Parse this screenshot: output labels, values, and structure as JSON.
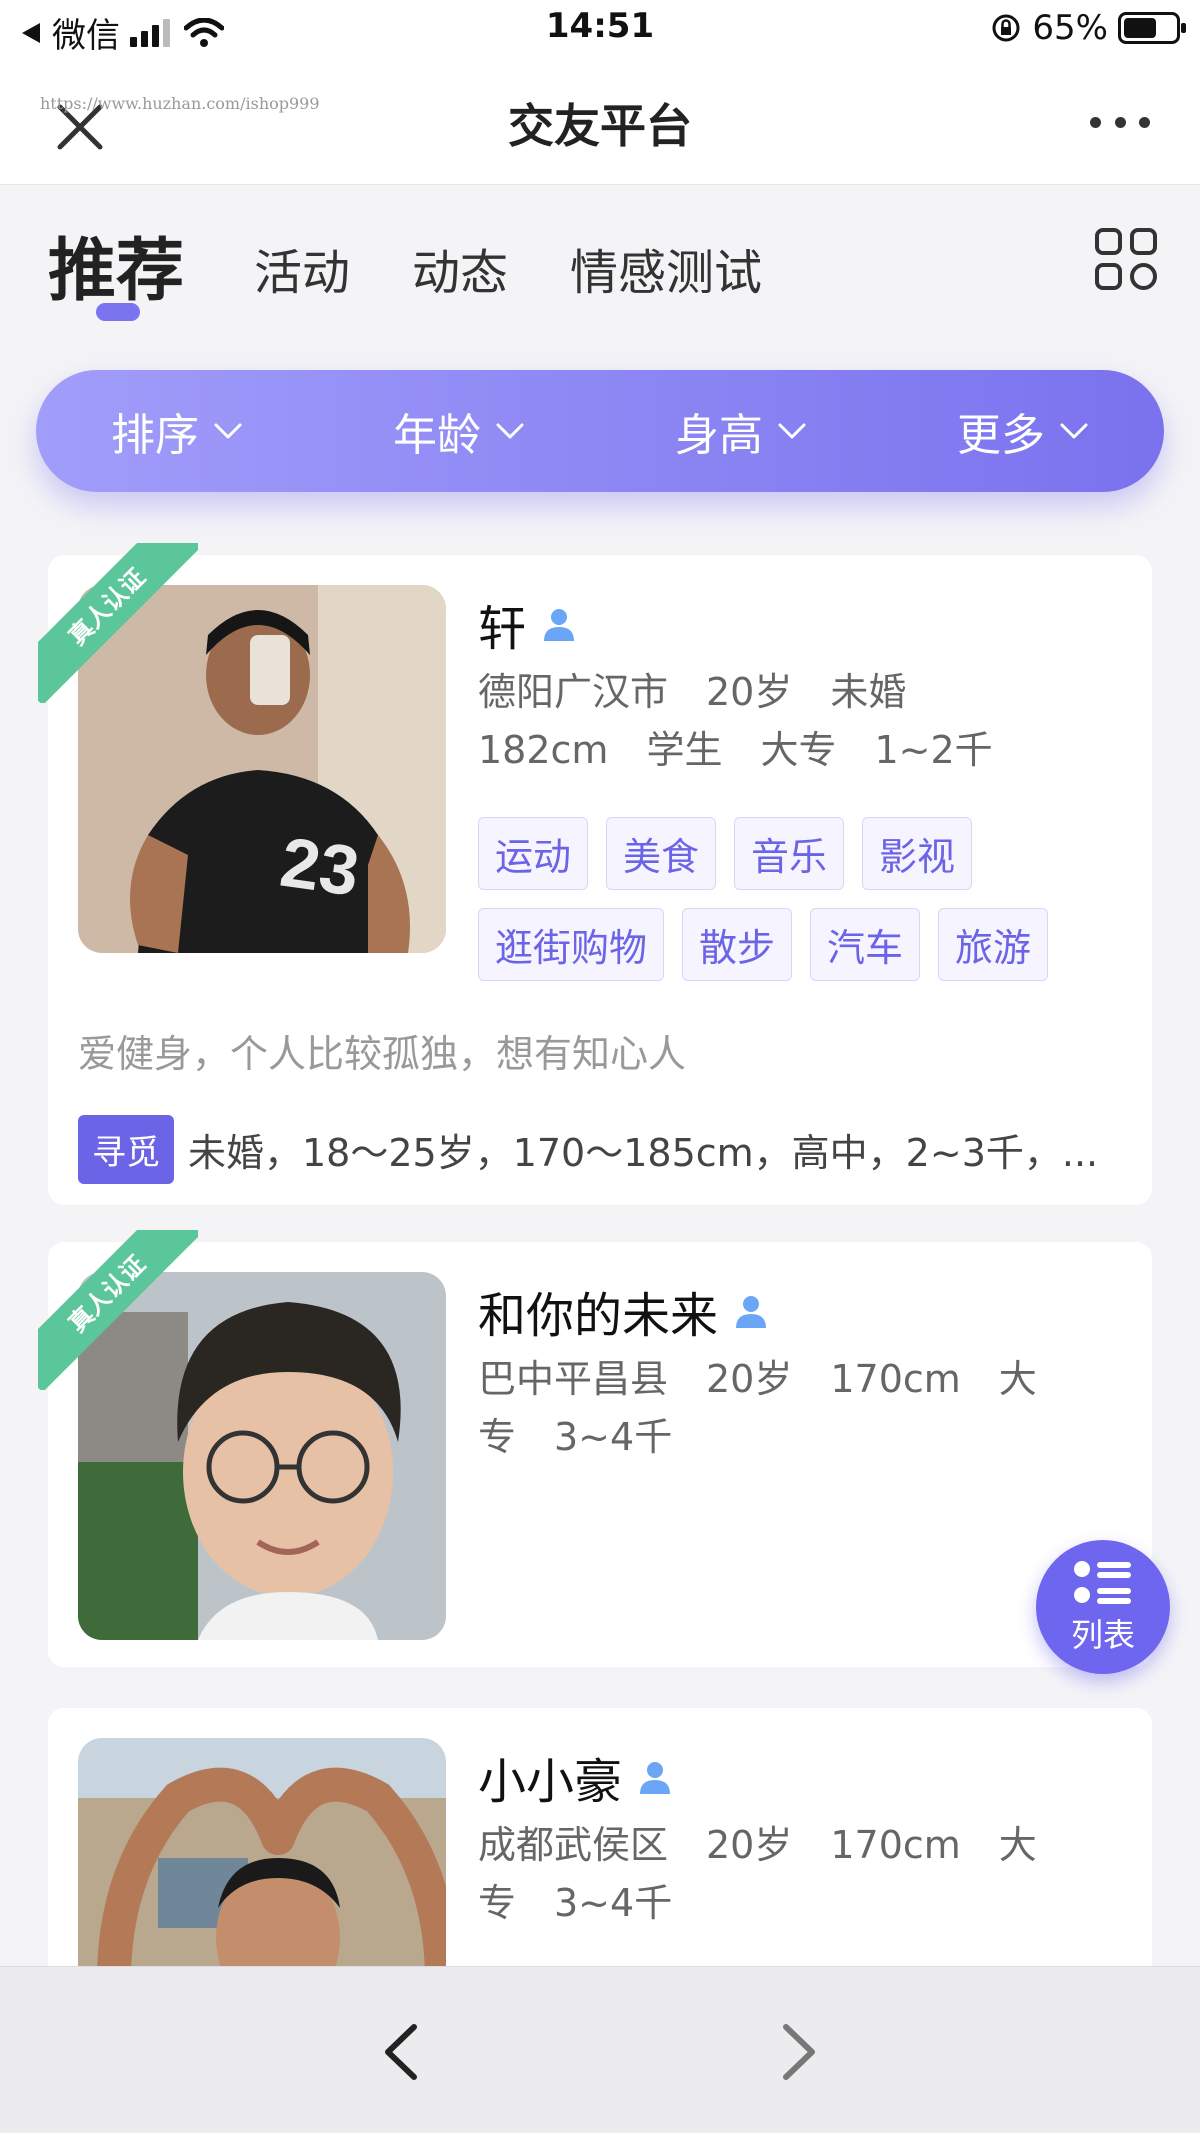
{
  "status_bar": {
    "back_app": "微信",
    "time": "14:51",
    "battery_percent": "65%",
    "battery_level": 0.65
  },
  "navbar": {
    "title": "交友平台",
    "watermark": "https://www.huzhan.com/ishop999"
  },
  "tabs": [
    {
      "label": "推荐",
      "active": true
    },
    {
      "label": "活动",
      "active": false
    },
    {
      "label": "动态",
      "active": false
    },
    {
      "label": "情感测试",
      "active": false
    }
  ],
  "filters": [
    {
      "label": "排序"
    },
    {
      "label": "年龄"
    },
    {
      "label": "身高"
    },
    {
      "label": "更多"
    }
  ],
  "verified_label": "真人认证",
  "profiles": [
    {
      "name": "轩",
      "verified": true,
      "meta_line1": "德阳广汉市　20岁　未婚",
      "meta_line2": "182cm　学生　大专　1~2千",
      "tags": [
        "运动",
        "美食",
        "音乐",
        "影视",
        "逛街购物",
        "散步",
        "汽车",
        "旅游"
      ],
      "bio": "爱健身，个人比较孤独，想有知心人",
      "seek_label": "寻觅",
      "seek_text": "未婚，18～25岁，170～185cm，高中，2~3千，..."
    },
    {
      "name": "和你的未来",
      "verified": true,
      "meta_line1": "巴中平昌县　20岁　170cm　大",
      "meta_line2": "专　3~4千"
    },
    {
      "name": "小小豪",
      "verified": false,
      "meta_line1": "成都武侯区　20岁　170cm　大",
      "meta_line2": "专　3~4千"
    }
  ],
  "fab": {
    "label": "列表"
  },
  "colors": {
    "accent": "#6c64e6",
    "verified": "#5bc699",
    "filter_start": "#a19dfa",
    "filter_end": "#7a72ee"
  }
}
